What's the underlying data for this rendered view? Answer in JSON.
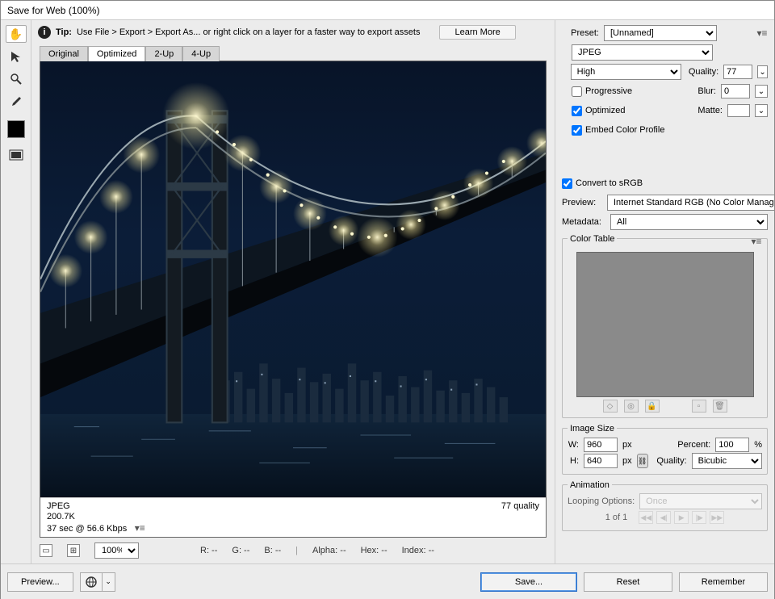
{
  "window": {
    "title": "Save for Web (100%)"
  },
  "tip": {
    "prefix": "Tip:",
    "text": "Use File > Export > Export As...   or right click on a layer for a faster way to export assets",
    "learn_more": "Learn More"
  },
  "tabs": {
    "original": "Original",
    "optimized": "Optimized",
    "two_up": "2-Up",
    "four_up": "4-Up"
  },
  "image_info": {
    "format": "JPEG",
    "size": "200.7K",
    "speed": "37 sec @ 56.6 Kbps",
    "quality": "77 quality"
  },
  "bottom": {
    "zoom": "100%",
    "r": "R: --",
    "g": "G: --",
    "b": "B: --",
    "alpha": "Alpha: --",
    "hex": "Hex: --",
    "index": "Index: --"
  },
  "preset": {
    "label": "Preset:",
    "value": "[Unnamed]",
    "format": "JPEG",
    "quality_preset": "High",
    "quality_label": "Quality:",
    "quality_value": "77",
    "blur_label": "Blur:",
    "blur_value": "0",
    "matte_label": "Matte:",
    "progressive": "Progressive",
    "optimized": "Optimized",
    "embed_profile": "Embed Color Profile"
  },
  "convert": {
    "srgb": "Convert to sRGB",
    "preview_label": "Preview:",
    "preview_value": "Internet Standard RGB (No Color Manag...",
    "metadata_label": "Metadata:",
    "metadata_value": "All"
  },
  "color_table": {
    "title": "Color Table"
  },
  "image_size": {
    "title": "Image Size",
    "w_label": "W:",
    "w_value": "960",
    "px": "px",
    "h_label": "H:",
    "h_value": "640",
    "percent_label": "Percent:",
    "percent_value": "100",
    "percent_suffix": "%",
    "quality_label": "Quality:",
    "quality_value": "Bicubic"
  },
  "animation": {
    "title": "Animation",
    "loop_label": "Looping Options:",
    "loop_value": "Once",
    "frame": "1 of 1"
  },
  "footer": {
    "preview": "Preview...",
    "save": "Save...",
    "reset": "Reset",
    "remember": "Remember"
  }
}
